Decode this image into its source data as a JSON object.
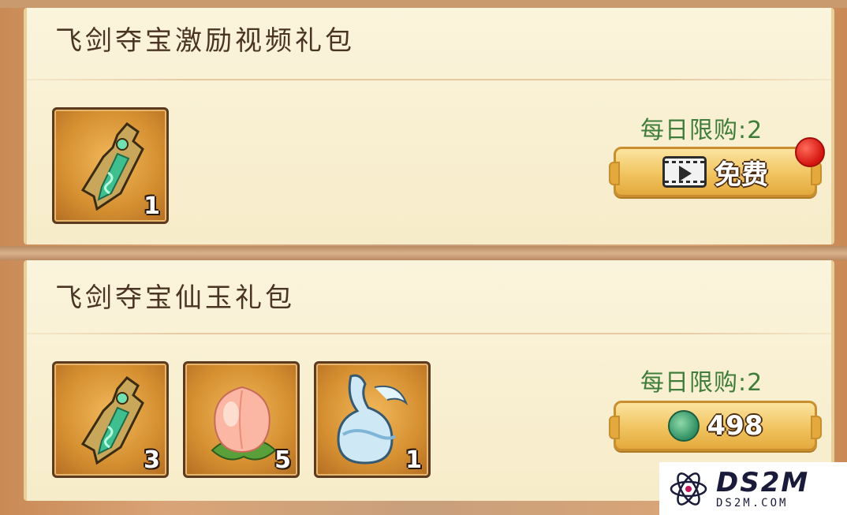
{
  "packs": [
    {
      "title": "飞剑夺宝激励视频礼包",
      "items": [
        {
          "icon": "jade-sword-icon",
          "count": "1"
        }
      ],
      "limit": "每日限购:2",
      "button": {
        "icon": "video-play-icon",
        "label": "免费"
      },
      "has_red_dot": true
    },
    {
      "title": "飞剑夺宝仙玉礼包",
      "items": [
        {
          "icon": "jade-sword-icon",
          "count": "3"
        },
        {
          "icon": "peach-icon",
          "count": "5"
        },
        {
          "icon": "water-gourd-icon",
          "count": "1"
        }
      ],
      "limit": "每日限购:2",
      "button": {
        "icon": "jade-currency-icon",
        "label": "498"
      },
      "has_red_dot": false
    }
  ],
  "watermark": {
    "title": "DS2M",
    "subtitle": "DS2M.COM"
  },
  "colors": {
    "limit_text": "#3f7d3a",
    "button_gold": "#f1c45f",
    "red_dot": "#d4140e"
  }
}
